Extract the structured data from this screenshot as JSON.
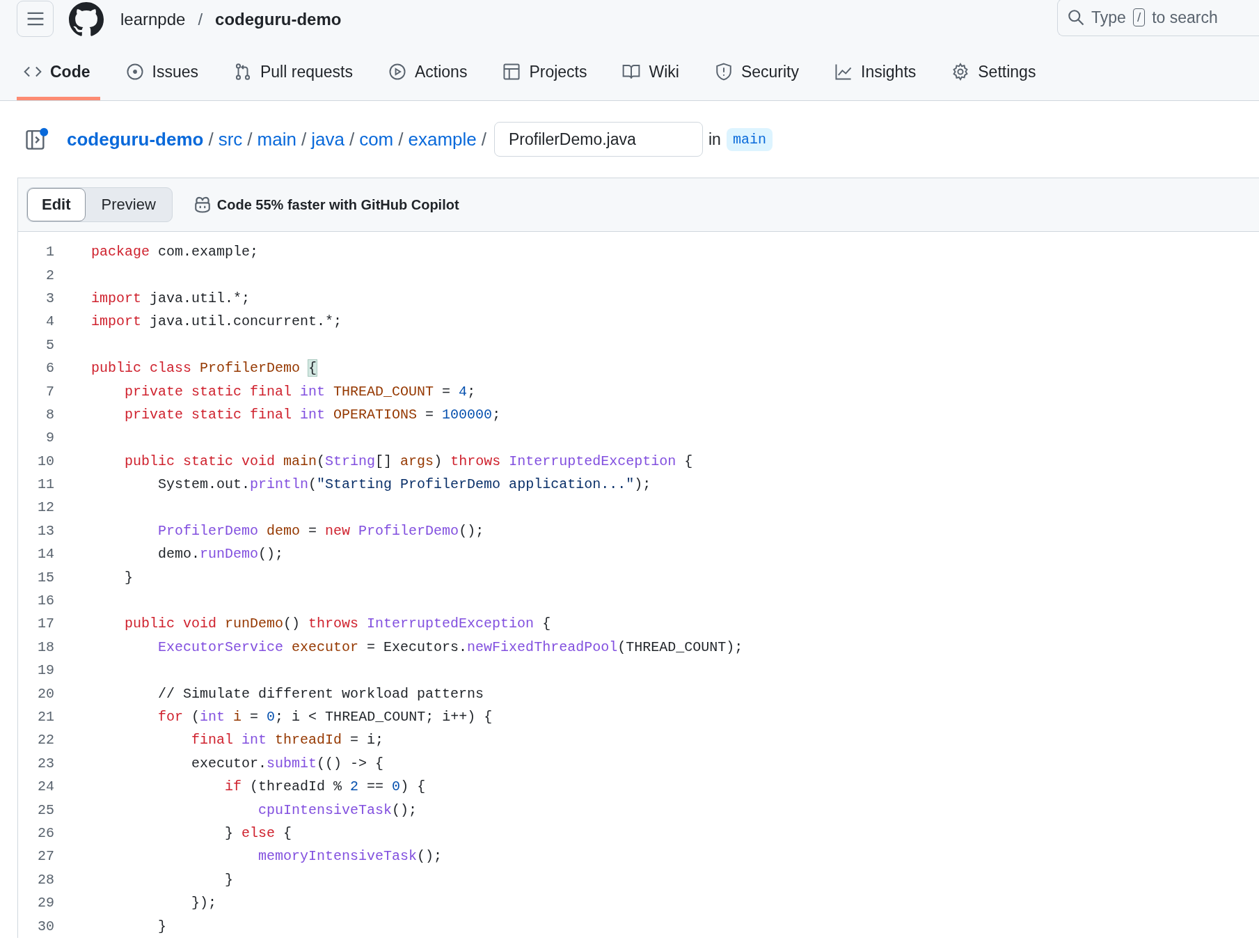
{
  "header": {
    "owner": "learnpde",
    "separator": "/",
    "repo": "codeguru-demo",
    "search": {
      "before_key": "Type",
      "key": "/",
      "after_key": "to search"
    }
  },
  "tabs": [
    {
      "label": "Code",
      "selected": true
    },
    {
      "label": "Issues",
      "selected": false
    },
    {
      "label": "Pull requests",
      "selected": false
    },
    {
      "label": "Actions",
      "selected": false
    },
    {
      "label": "Projects",
      "selected": false
    },
    {
      "label": "Wiki",
      "selected": false
    },
    {
      "label": "Security",
      "selected": false
    },
    {
      "label": "Insights",
      "selected": false
    },
    {
      "label": "Settings",
      "selected": false
    }
  ],
  "breadcrumb": {
    "segments": [
      {
        "name": "codeguru-demo",
        "sep": "/"
      },
      {
        "name": "src",
        "sep": "/"
      },
      {
        "name": "main",
        "sep": "/"
      },
      {
        "name": "java",
        "sep": "/"
      },
      {
        "name": "com",
        "sep": "/"
      },
      {
        "name": "example",
        "sep": "/"
      }
    ],
    "filename": "ProfilerDemo.java",
    "in_label": "in",
    "branch": "main"
  },
  "editor": {
    "modes": [
      {
        "label": "Edit",
        "selected": true
      },
      {
        "label": "Preview",
        "selected": false
      }
    ],
    "copilot": "Code 55% faster with GitHub Copilot",
    "lines": [
      {
        "n": "1",
        "tokens": [
          {
            "t": "package",
            "kind": "kw"
          },
          {
            "t": " com.example;"
          }
        ]
      },
      {
        "n": "2"
      },
      {
        "n": "3",
        "tokens": [
          {
            "t": "import",
            "kind": "kw"
          },
          {
            "t": " java.util.*;"
          }
        ]
      },
      {
        "n": "4",
        "tokens": [
          {
            "t": "import",
            "kind": "kw"
          },
          {
            "t": " java.util.concurrent.*;"
          }
        ]
      },
      {
        "n": "5"
      },
      {
        "n": "6",
        "tokens": [
          {
            "t": "public class",
            "kind": "kw"
          },
          {
            "t": " ProfilerDemo ",
            "kind": "def"
          },
          {
            "t": "{",
            "kind": "br"
          }
        ]
      },
      {
        "n": "7",
        "tokens": [
          {
            "t": "    private static final",
            "kind": "kw"
          },
          {
            "t": " int",
            "kind": "type"
          },
          {
            "t": " THREAD_COUNT",
            "kind": "def"
          },
          {
            "t": " = "
          },
          {
            "t": "4",
            "kind": "num"
          },
          {
            "t": ";"
          }
        ]
      },
      {
        "n": "8",
        "tokens": [
          {
            "t": "    private static final",
            "kind": "kw"
          },
          {
            "t": " int",
            "kind": "type"
          },
          {
            "t": " OPERATIONS",
            "kind": "def"
          },
          {
            "t": " = "
          },
          {
            "t": "100000",
            "kind": "num"
          },
          {
            "t": ";"
          }
        ]
      },
      {
        "n": "9"
      },
      {
        "n": "10",
        "tokens": [
          {
            "t": "    public static void",
            "kind": "kw"
          },
          {
            "t": " main",
            "kind": "def"
          },
          {
            "t": "("
          },
          {
            "t": "String",
            "kind": "type"
          },
          {
            "t": "[] "
          },
          {
            "t": "args",
            "kind": "def"
          },
          {
            "t": ") "
          },
          {
            "t": "throws",
            "kind": "kw"
          },
          {
            "t": " InterruptedException",
            "kind": "type"
          },
          {
            "t": " {"
          }
        ]
      },
      {
        "n": "11",
        "tokens": [
          {
            "t": "        System.out."
          },
          {
            "t": "println",
            "kind": "fn"
          },
          {
            "t": "("
          },
          {
            "t": "\"Starting ProfilerDemo application...\"",
            "kind": "str"
          },
          {
            "t": ");"
          }
        ]
      },
      {
        "n": "12"
      },
      {
        "n": "13",
        "tokens": [
          {
            "t": "        ProfilerDemo",
            "kind": "type"
          },
          {
            "t": " demo",
            "kind": "def"
          },
          {
            "t": " = "
          },
          {
            "t": "new",
            "kind": "kw"
          },
          {
            "t": " ProfilerDemo",
            "kind": "type"
          },
          {
            "t": "();"
          }
        ]
      },
      {
        "n": "14",
        "tokens": [
          {
            "t": "        demo."
          },
          {
            "t": "runDemo",
            "kind": "fn"
          },
          {
            "t": "();"
          }
        ]
      },
      {
        "n": "15",
        "tokens": [
          {
            "t": "    }"
          }
        ]
      },
      {
        "n": "16"
      },
      {
        "n": "17",
        "tokens": [
          {
            "t": "    public void",
            "kind": "kw"
          },
          {
            "t": " runDemo",
            "kind": "def"
          },
          {
            "t": "() "
          },
          {
            "t": "throws",
            "kind": "kw"
          },
          {
            "t": " InterruptedException",
            "kind": "type"
          },
          {
            "t": " {"
          }
        ]
      },
      {
        "n": "18",
        "tokens": [
          {
            "t": "        ExecutorService",
            "kind": "type"
          },
          {
            "t": " executor",
            "kind": "def"
          },
          {
            "t": " = Executors."
          },
          {
            "t": "newFixedThreadPool",
            "kind": "fn"
          },
          {
            "t": "(THREAD_COUNT);"
          }
        ]
      },
      {
        "n": "19"
      },
      {
        "n": "20",
        "tokens": [
          {
            "t": "        // Simulate different workload patterns"
          }
        ]
      },
      {
        "n": "21",
        "tokens": [
          {
            "t": "        for",
            "kind": "kw"
          },
          {
            "t": " ("
          },
          {
            "t": "int",
            "kind": "type"
          },
          {
            "t": " i",
            "kind": "def"
          },
          {
            "t": " = "
          },
          {
            "t": "0",
            "kind": "num"
          },
          {
            "t": "; i < THREAD_COUNT; i++) {"
          }
        ]
      },
      {
        "n": "22",
        "tokens": [
          {
            "t": "            final",
            "kind": "kw"
          },
          {
            "t": " int",
            "kind": "type"
          },
          {
            "t": " threadId",
            "kind": "def"
          },
          {
            "t": " = i;"
          }
        ]
      },
      {
        "n": "23",
        "tokens": [
          {
            "t": "            executor."
          },
          {
            "t": "submit",
            "kind": "fn"
          },
          {
            "t": "(() -> {"
          }
        ]
      },
      {
        "n": "24",
        "tokens": [
          {
            "t": "                if",
            "kind": "kw"
          },
          {
            "t": " (threadId % "
          },
          {
            "t": "2",
            "kind": "num"
          },
          {
            "t": " == "
          },
          {
            "t": "0",
            "kind": "num"
          },
          {
            "t": ") {"
          }
        ]
      },
      {
        "n": "25",
        "tokens": [
          {
            "t": "                    cpuIntensiveTask",
            "kind": "fn"
          },
          {
            "t": "();"
          }
        ]
      },
      {
        "n": "26",
        "tokens": [
          {
            "t": "                } "
          },
          {
            "t": "else",
            "kind": "kw"
          },
          {
            "t": " {"
          }
        ]
      },
      {
        "n": "27",
        "tokens": [
          {
            "t": "                    memoryIntensiveTask",
            "kind": "fn"
          },
          {
            "t": "();"
          }
        ]
      },
      {
        "n": "28",
        "tokens": [
          {
            "t": "                }"
          }
        ]
      },
      {
        "n": "29",
        "tokens": [
          {
            "t": "            });"
          }
        ]
      },
      {
        "n": "30",
        "tokens": [
          {
            "t": "        }"
          }
        ]
      }
    ]
  }
}
